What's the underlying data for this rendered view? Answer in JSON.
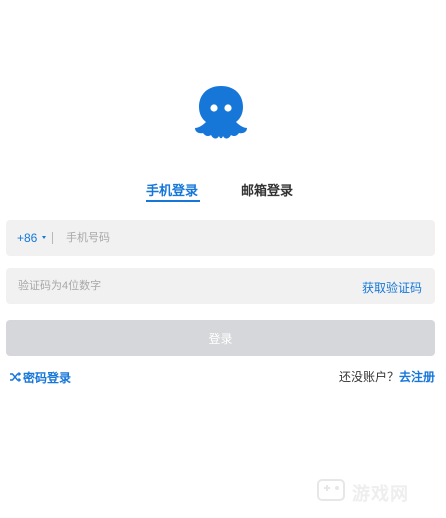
{
  "brand": {
    "logo_icon": "octopus-icon",
    "accent_color": "#1677d9"
  },
  "tabs": [
    {
      "label": "手机登录",
      "active": true
    },
    {
      "label": "邮箱登录",
      "active": false
    }
  ],
  "phone_field": {
    "country_code": "+86",
    "placeholder": "手机号码"
  },
  "code_field": {
    "placeholder": "验证码为4位数字",
    "get_code_label": "获取验证码"
  },
  "login_button": {
    "label": "登录"
  },
  "password_login": {
    "icon": "shuffle-icon",
    "label": "密码登录"
  },
  "signup": {
    "prompt": "还没账户？",
    "link_label": "去注册"
  },
  "watermark": {
    "text": "游戏网"
  }
}
